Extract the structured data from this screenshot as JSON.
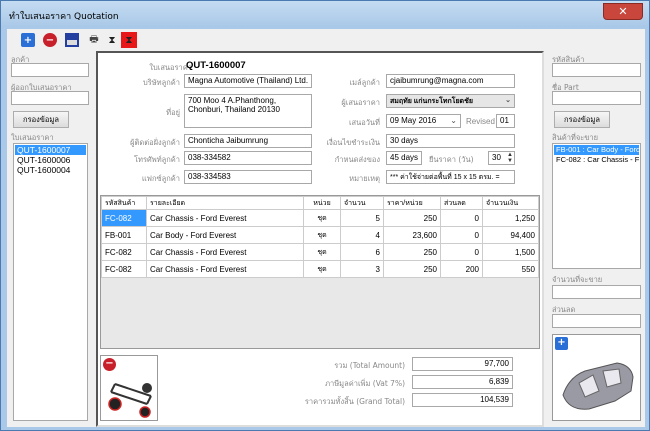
{
  "window": {
    "title": "ทำใบเสนอราคา Quotation",
    "close": "✕"
  },
  "toolbar": {
    "icons": [
      "add-icon",
      "delete-icon",
      "save-icon",
      "print-icon",
      "hourglass-icon",
      "hourglass-red-icon"
    ]
  },
  "left": {
    "customer_label": "ลูกค้า",
    "customer_value": "",
    "issuer_label": "ผู้ออกใบเสนอราคา",
    "issuer_value": "",
    "filter_button": "กรองข้อมูล",
    "list_label": "ใบเสนอราคา",
    "quotations": [
      "QUT-1600007",
      "QUT-1600006",
      "QUT-1600004"
    ],
    "selected": 0
  },
  "form": {
    "quotation_label": "ใบเสนอราคา",
    "quotation_no": "QUT-1600007",
    "company_label": "บริษัทลูกค้า",
    "company": "Magna Automotive (Thailand) Ltd.",
    "address_label": "ที่อยู่",
    "address": "700 Moo 4 A.Phanthong, Chonburi, Thailand 20130",
    "contact_label": "ผู้ติดต่อฝั่งลูกค้า",
    "contact": "Chonticha Jaibumrung",
    "phone_label": "โทรศัพท์ลูกค้า",
    "phone": "038-334582",
    "fax_label": "แฟกซ์ลูกค้า",
    "fax": "038-334583",
    "email_label": "เมล์ลูกค้า",
    "email": "cjaibumrung@magna.com",
    "quoter_label": "ผู้เสนอราคา",
    "quoter": "สมฤทัย แก่นกระโทกโยดชัย",
    "date_label": "เสนอวันที่",
    "date": "09 May 2016",
    "revised_label": "Revised",
    "revised": "01",
    "payment_label": "เงื่อนไขชำระเงิน",
    "payment": "30 days",
    "delivery_label": "กำหนดส่งของ",
    "delivery": "45 days",
    "validity_label": "ยืนราคา (วัน)",
    "validity": "30",
    "remark_label": "หมายเหตุ",
    "remark": "*** ค่าใช้จ่ายต่อพื้นที่ 15 x 15 ตรม. ="
  },
  "grid": {
    "columns": [
      "รหัสสินค้า",
      "รายละเอียด",
      "หน่วย",
      "จำนวน",
      "ราคา/หน่วย",
      "ส่วนลด",
      "จำนวนเงิน"
    ],
    "rows": [
      [
        "FC-082",
        "Car Chassis - Ford Everest",
        "ชุด",
        "5",
        "250",
        "0",
        "1,250"
      ],
      [
        "FB-001",
        "Car Body - Ford Everest",
        "ชุด",
        "4",
        "23,600",
        "0",
        "94,400"
      ],
      [
        "FC-082",
        "Car Chassis - Ford Everest",
        "ชุด",
        "6",
        "250",
        "0",
        "1,500"
      ],
      [
        "FC-082",
        "Car Chassis - Ford Everest",
        "ชุด",
        "3",
        "250",
        "200",
        "550"
      ]
    ]
  },
  "totals": {
    "total_label": "รวม (Total Amount)",
    "total": "97,700",
    "vat_label": "ภาษีมูลค่าเพิ่ม (Vat 7%)",
    "vat": "6,839",
    "grand_label": "ราคารวมทั้งสิ้น (Grand Total)",
    "grand": "104,539"
  },
  "right": {
    "code_label": "รหัสสินค้า",
    "code_value": "",
    "part_label": "ชื่อ Part",
    "part_value": "",
    "filter_button": "กรองข้อมูล",
    "list_label": "สินค้าที่จะขาย",
    "products": [
      "FB-001 : Car Body - Ford Everest",
      "FC-082 : Car Chassis - Ford Everest"
    ],
    "selected": 0,
    "qty_label": "จำนวนที่จะขาย",
    "qty_value": "",
    "discount_label": "ส่วนลด",
    "discount_value": ""
  }
}
